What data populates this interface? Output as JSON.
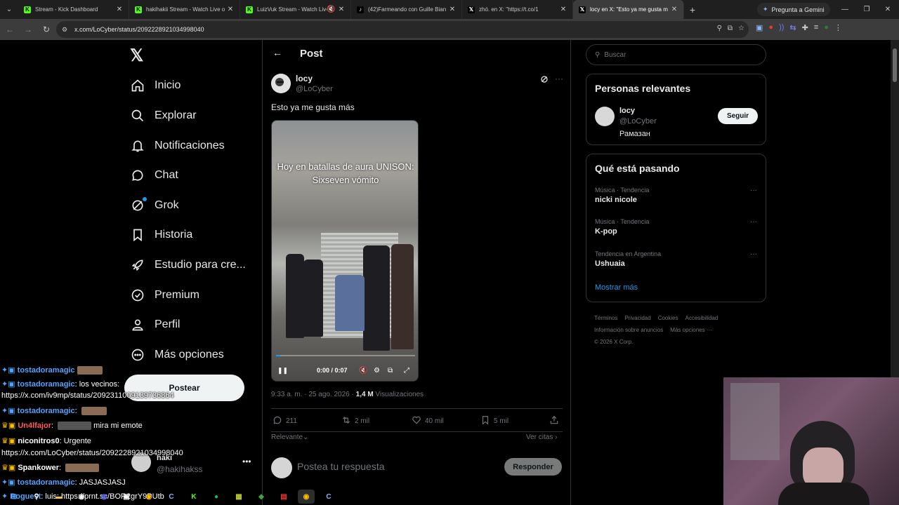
{
  "browser": {
    "tabs": [
      {
        "title": "Stream - Kick Dashboard",
        "fav": "K",
        "color": "#53fc18"
      },
      {
        "title": "hakihakii Stream - Watch Live o",
        "fav": "K",
        "color": "#53fc18"
      },
      {
        "title": "LuizVuk Stream - Watch Live",
        "fav": "K",
        "color": "#53fc18"
      },
      {
        "title": "(42)Farmeando con Guille Bian",
        "fav": "♪",
        "color": "#ffffff"
      },
      {
        "title": "zhó.     en X: \"https://t.co/1",
        "fav": "𝕏",
        "color": "#ffffff"
      },
      {
        "title": "locy en X: \"Esto ya me gusta m",
        "fav": "𝕏",
        "color": "#ffffff"
      }
    ],
    "gemini_label": "Pregunta a Gemini",
    "url": "x.com/LoCyber/status/2092228921034998040"
  },
  "x": {
    "logo": "𝕏",
    "nav": [
      {
        "label": "Inicio",
        "icon": "home-icon",
        "glyph": "⌂"
      },
      {
        "label": "Explorar",
        "icon": "search-icon",
        "glyph": "⚲"
      },
      {
        "label": "Notificaciones",
        "icon": "bell-icon",
        "glyph": "🔔"
      },
      {
        "label": "Chat",
        "icon": "chat-icon",
        "glyph": "◯"
      },
      {
        "label": "Grok",
        "icon": "grok-icon",
        "glyph": "◎"
      },
      {
        "label": "Historia",
        "icon": "bookmark-icon",
        "glyph": "⌑"
      },
      {
        "label": "Estudio para cre...",
        "icon": "rocket-icon",
        "glyph": "➚"
      },
      {
        "label": "Premium",
        "icon": "premium-icon",
        "glyph": "✓"
      },
      {
        "label": "Perfil",
        "icon": "profile-icon",
        "glyph": "👤"
      },
      {
        "label": "Más opciones",
        "icon": "more-options-icon",
        "glyph": "⋯"
      }
    ],
    "post_button": "Postear",
    "account": {
      "name": "haki",
      "handle": "@hakihakss"
    },
    "header_title": "Post",
    "tweet": {
      "name": "locy",
      "handle": "@LoCyber",
      "text": "Esto ya me gusta más",
      "video_caption_1": "Hoy en batallas de aura UNISON:",
      "video_caption_2": "Sixseven vómito",
      "video_time": "0:00 / 0:07",
      "video_progress": 0.03,
      "timestamp": "9:33 a. m. · 25 ago. 2026 · ",
      "views_count": "1,4 M",
      "views_label": " Visualizaciones",
      "replies": "211",
      "reposts": "2 mil",
      "likes": "40 mil",
      "bookmarks": "5 mil",
      "sort_label": "Relevante",
      "quotes_label": "Ver citas",
      "reply_placeholder": "Postea tu respuesta",
      "reply_button": "Responder"
    },
    "search_placeholder": "Buscar",
    "relevant": {
      "title": "Personas relevantes",
      "name": "locy",
      "handle": "@LoCyber",
      "bio": "Рамазан",
      "follow": "Seguir"
    },
    "trends": {
      "title": "Qué está pasando",
      "items": [
        {
          "context": "Música · Tendencia",
          "topic": "nicki nicole"
        },
        {
          "context": "Música · Tendencia",
          "topic": "K-pop"
        },
        {
          "context": "Tendencia en Argentina",
          "topic": "Ushuaia"
        }
      ],
      "show_more": "Mostrar más"
    },
    "footer": {
      "links": [
        "Términos",
        "Privacidad",
        "Cookies",
        "Accesibilidad",
        "Información sobre anuncios",
        "Más opciones ···"
      ],
      "copyright": "© 2026 X Corp."
    }
  },
  "chat": [
    {
      "user": "tostadoramagic",
      "text": "",
      "color": "#4ea4ff"
    },
    {
      "user": "tostadoramagic",
      "text": "los vecinos:",
      "color": "#4ea4ff"
    },
    {
      "user": "",
      "text": "https://x.com/iv9mp/status/2092311009139736864",
      "color": "#ffffff"
    },
    {
      "user": "tostadoramagic",
      "text": "",
      "color": "#4ea4ff"
    },
    {
      "user": "Un4lfajor",
      "text": "mira mi emote",
      "color": "#ff5a5a"
    },
    {
      "user": "niconitros0",
      "text": "Urgente",
      "color": "#ffffff"
    },
    {
      "user": "",
      "text": "https://x.com/LoCyber/status/2092228921034998040",
      "color": "#ffffff"
    },
    {
      "user": "Spankower",
      "text": "",
      "color": "#ffffff"
    },
    {
      "user": "tostadoramagic",
      "text": "JASJASJASJ",
      "color": "#4ea4ff"
    },
    {
      "user": "Roguest",
      "text": "luis: https://prnt.sc/BOR2grY9PUtb",
      "color": "#4ea4ff"
    }
  ]
}
